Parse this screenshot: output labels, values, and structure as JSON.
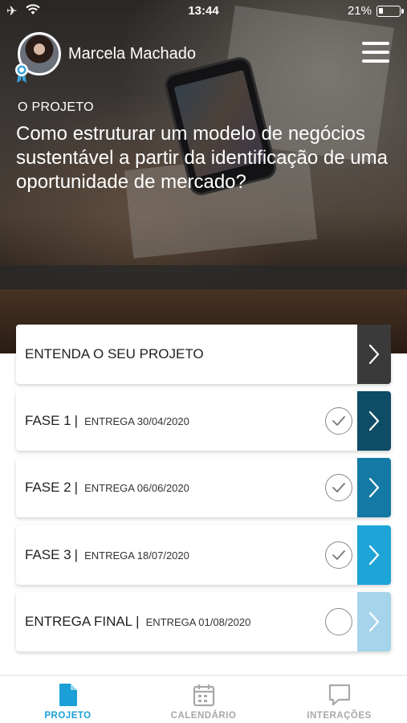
{
  "status_bar": {
    "time": "13:44",
    "battery_text": "21%",
    "battery_level": 0.21
  },
  "header": {
    "user_name": "Marcela Machado",
    "menu_icon": "hamburger-menu-icon"
  },
  "project": {
    "eyebrow": "O PROJETO",
    "title": "Como estruturar um modelo de negócios sustentável a partir da identificação de uma oportunidade de mercado?"
  },
  "cards": [
    {
      "label": "ENTENDA O SEU PROJETO",
      "delivery": "",
      "completed": null,
      "arrow_color": "#3a3a3a"
    },
    {
      "label": "FASE 1",
      "delivery": "ENTREGA 30/04/2020",
      "completed": true,
      "arrow_color": "#0f4c66"
    },
    {
      "label": "FASE 2",
      "delivery": "ENTREGA 06/06/2020",
      "completed": true,
      "arrow_color": "#1479a4"
    },
    {
      "label": "FASE 3",
      "delivery": "ENTREGA 18/07/2020",
      "completed": true,
      "arrow_color": "#1ea5d8"
    },
    {
      "label": "ENTREGA FINAL",
      "delivery": "ENTREGA 01/08/2020",
      "completed": false,
      "arrow_color": "#a6d4ea"
    }
  ],
  "separator": "|",
  "tabs": [
    {
      "label": "PROJETO",
      "icon": "document-icon",
      "active": true
    },
    {
      "label": "CALENDÁRIO",
      "icon": "calendar-icon",
      "active": false
    },
    {
      "label": "INTERAÇÕES",
      "icon": "chat-bubble-icon",
      "active": false
    }
  ],
  "colors": {
    "active_tab": "#1a9fd6",
    "inactive_tab": "#a8a8a8"
  }
}
